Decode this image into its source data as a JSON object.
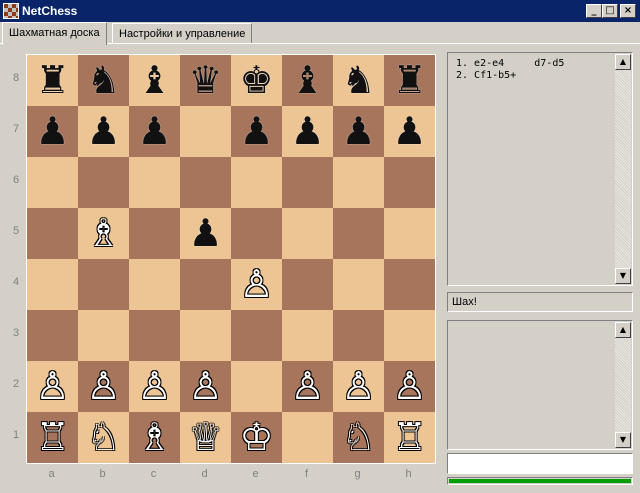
{
  "window": {
    "title": "NetChess"
  },
  "tabs": [
    {
      "label": "Шахматная доска",
      "active": true
    },
    {
      "label": "Настройки и управление",
      "active": false
    }
  ],
  "board": {
    "ranks": [
      "8",
      "7",
      "6",
      "5",
      "4",
      "3",
      "2",
      "1"
    ],
    "files": [
      "a",
      "b",
      "c",
      "d",
      "e",
      "f",
      "g",
      "h"
    ],
    "pieces": [
      {
        "square": "a8",
        "glyph": "♜",
        "color": "black",
        "name": "black-rook"
      },
      {
        "square": "b8",
        "glyph": "♞",
        "color": "black",
        "name": "black-knight"
      },
      {
        "square": "c8",
        "glyph": "♝",
        "color": "black",
        "name": "black-bishop"
      },
      {
        "square": "d8",
        "glyph": "♛",
        "color": "black",
        "name": "black-queen"
      },
      {
        "square": "e8",
        "glyph": "♚",
        "color": "black",
        "name": "black-king"
      },
      {
        "square": "f8",
        "glyph": "♝",
        "color": "black",
        "name": "black-bishop"
      },
      {
        "square": "g8",
        "glyph": "♞",
        "color": "black",
        "name": "black-knight"
      },
      {
        "square": "h8",
        "glyph": "♜",
        "color": "black",
        "name": "black-rook"
      },
      {
        "square": "a7",
        "glyph": "♟",
        "color": "black",
        "name": "black-pawn"
      },
      {
        "square": "b7",
        "glyph": "♟",
        "color": "black",
        "name": "black-pawn"
      },
      {
        "square": "c7",
        "glyph": "♟",
        "color": "black",
        "name": "black-pawn"
      },
      {
        "square": "e7",
        "glyph": "♟",
        "color": "black",
        "name": "black-pawn"
      },
      {
        "square": "f7",
        "glyph": "♟",
        "color": "black",
        "name": "black-pawn"
      },
      {
        "square": "g7",
        "glyph": "♟",
        "color": "black",
        "name": "black-pawn"
      },
      {
        "square": "h7",
        "glyph": "♟",
        "color": "black",
        "name": "black-pawn"
      },
      {
        "square": "b5",
        "glyph": "♗",
        "color": "white",
        "name": "white-bishop"
      },
      {
        "square": "d5",
        "glyph": "♟",
        "color": "black",
        "name": "black-pawn"
      },
      {
        "square": "e4",
        "glyph": "♙",
        "color": "white",
        "name": "white-pawn"
      },
      {
        "square": "a2",
        "glyph": "♙",
        "color": "white",
        "name": "white-pawn"
      },
      {
        "square": "b2",
        "glyph": "♙",
        "color": "white",
        "name": "white-pawn"
      },
      {
        "square": "c2",
        "glyph": "♙",
        "color": "white",
        "name": "white-pawn"
      },
      {
        "square": "d2",
        "glyph": "♙",
        "color": "white",
        "name": "white-pawn"
      },
      {
        "square": "f2",
        "glyph": "♙",
        "color": "white",
        "name": "white-pawn"
      },
      {
        "square": "g2",
        "glyph": "♙",
        "color": "white",
        "name": "white-pawn"
      },
      {
        "square": "h2",
        "glyph": "♙",
        "color": "white",
        "name": "white-pawn"
      },
      {
        "square": "a1",
        "glyph": "♖",
        "color": "white",
        "name": "white-rook"
      },
      {
        "square": "b1",
        "glyph": "♘",
        "color": "white",
        "name": "white-knight"
      },
      {
        "square": "c1",
        "glyph": "♗",
        "color": "white",
        "name": "white-bishop"
      },
      {
        "square": "d1",
        "glyph": "♕",
        "color": "white",
        "name": "white-queen"
      },
      {
        "square": "e1",
        "glyph": "♔",
        "color": "white",
        "name": "white-king"
      },
      {
        "square": "g1",
        "glyph": "♘",
        "color": "white",
        "name": "white-knight"
      },
      {
        "square": "h1",
        "glyph": "♖",
        "color": "white",
        "name": "white-rook"
      }
    ],
    "colors": {
      "light": "#edc595",
      "dark": "#a6755c"
    }
  },
  "moves": [
    {
      "num": "1.",
      "white": "e2-e4",
      "black": "d7-d5"
    },
    {
      "num": "2.",
      "white": "Cf1-b5+",
      "black": ""
    }
  ],
  "status": {
    "text": "Шах!"
  },
  "chat": {
    "input_value": ""
  },
  "progress": {
    "fraction": 1.0,
    "color": "#00a000"
  }
}
